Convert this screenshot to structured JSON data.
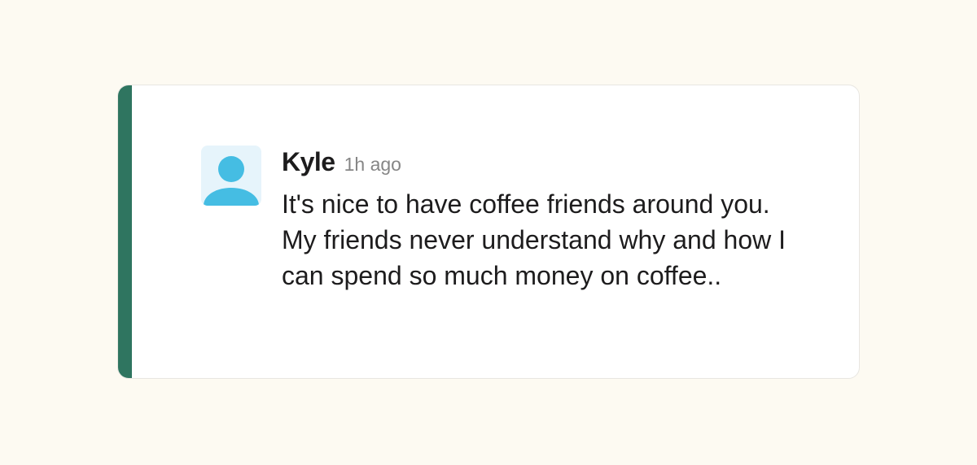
{
  "message": {
    "author": "Kyle",
    "timestamp": "1h ago",
    "text": "It's nice to have coffee friends around you. My friends never understand why and how I can spend so much money on coffee.."
  },
  "avatar": {
    "icon": "user-silhouette-icon",
    "background_color": "#e6f4fb",
    "icon_color": "#45bde3"
  },
  "colors": {
    "page_background": "#fdfaf2",
    "accent_bar": "#2f7560",
    "card_background": "#ffffff"
  }
}
